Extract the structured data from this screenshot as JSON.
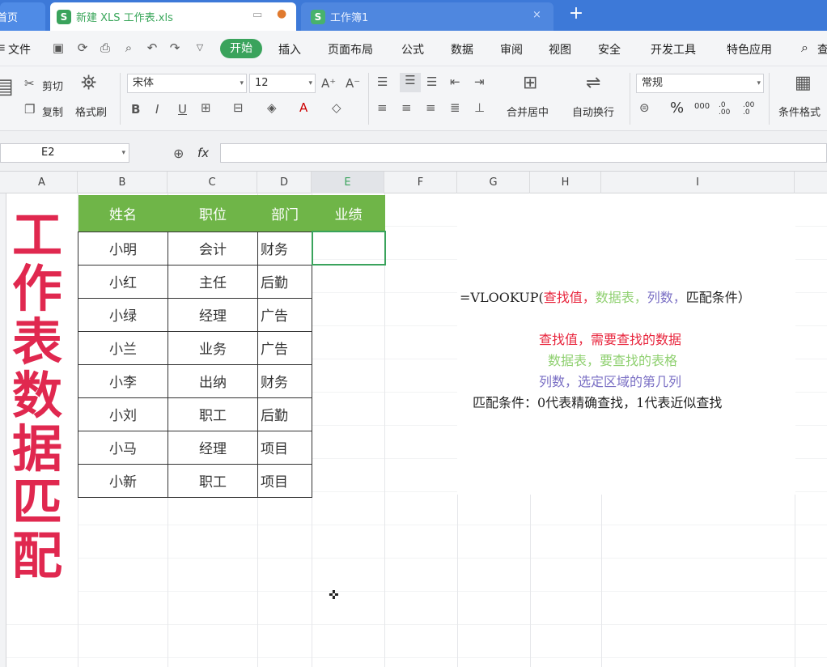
{
  "tabs": {
    "home_label": "首页",
    "file_label": "新建 XLS 工作表.xls",
    "book_label": "工作簿1",
    "new_tab": "+"
  },
  "menu": {
    "file": "文件",
    "items": [
      "开始",
      "插入",
      "页面布局",
      "公式",
      "数据",
      "审阅",
      "视图",
      "安全",
      "开发工具",
      "特色应用"
    ],
    "search_label": "查"
  },
  "ribbon": {
    "cut": "剪切",
    "copy": "复制",
    "format_painter": "格式刷",
    "font_name": "宋体",
    "font_size": "12",
    "merge_center": "合并居中",
    "wrap_text": "自动换行",
    "number_format": "常规",
    "conditional_format": "条件格式",
    "percent": "%",
    "thousands": "000",
    "dec_inc": ".0 .00",
    "dec_dec": ".00 .0"
  },
  "formula_bar": {
    "cell_ref": "E2",
    "fx": "fx",
    "content": ""
  },
  "columns": [
    "A",
    "B",
    "C",
    "D",
    "E",
    "F",
    "G",
    "H",
    "I"
  ],
  "title_text": "工作表数据匹配",
  "table": {
    "headers": [
      "姓名",
      "职位",
      "部门",
      "业绩"
    ],
    "rows": [
      [
        "小明",
        "会计",
        "财务"
      ],
      [
        "小红",
        "主任",
        "后勤"
      ],
      [
        "小绿",
        "经理",
        "广告"
      ],
      [
        "小兰",
        "业务",
        "广告"
      ],
      [
        "小李",
        "出纳",
        "财务"
      ],
      [
        "小刘",
        "职工",
        "后勤"
      ],
      [
        "小马",
        "经理",
        "项目"
      ],
      [
        "小新",
        "职工",
        "项目"
      ]
    ]
  },
  "notes": {
    "formula_prefix": "=VLOOKUP(",
    "formula_p1": "查找值，",
    "formula_p2": "数据表，",
    "formula_p3": "列数，",
    "formula_p4": "匹配条件）",
    "line1": "查找值，需要查找的数据",
    "line2": "数据表，要查找的表格",
    "line3": "列数，选定区域的第几列",
    "line4": "匹配条件：0代表精确查找，1代表近似查找"
  },
  "colors": {
    "accent_green": "#3aa35c",
    "header_green": "#6fb548",
    "title_red": "#e0284f",
    "note_red": "#e8243c",
    "note_green": "#8fd070",
    "note_purple": "#7a6fc4"
  }
}
